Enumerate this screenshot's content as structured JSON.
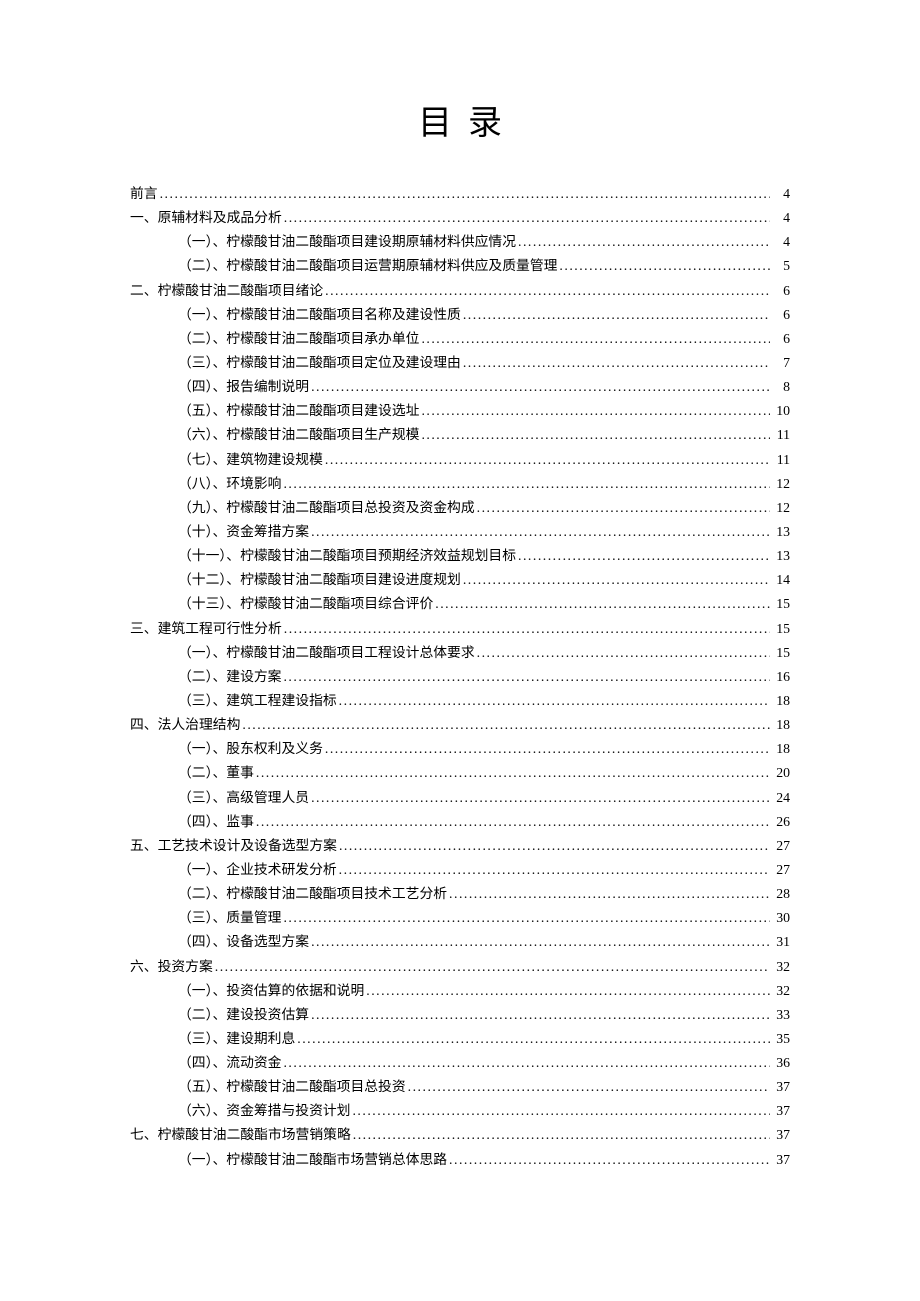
{
  "title": "目录",
  "toc": [
    {
      "level": 1,
      "label": "前言",
      "page": "4"
    },
    {
      "level": 1,
      "label": "一、原辅材料及成品分析",
      "page": "4"
    },
    {
      "level": 2,
      "label": "（一）、柠檬酸甘油二酸酯项目建设期原辅材料供应情况",
      "page": "4"
    },
    {
      "level": 2,
      "label": "（二）、柠檬酸甘油二酸酯项目运营期原辅材料供应及质量管理",
      "page": "5"
    },
    {
      "level": 1,
      "label": "二、柠檬酸甘油二酸酯项目绪论",
      "page": "6"
    },
    {
      "level": 2,
      "label": "（一）、柠檬酸甘油二酸酯项目名称及建设性质",
      "page": "6"
    },
    {
      "level": 2,
      "label": "（二）、柠檬酸甘油二酸酯项目承办单位",
      "page": "6"
    },
    {
      "level": 2,
      "label": "（三）、柠檬酸甘油二酸酯项目定位及建设理由",
      "page": "7"
    },
    {
      "level": 2,
      "label": "（四）、报告编制说明",
      "page": "8"
    },
    {
      "level": 2,
      "label": "（五）、柠檬酸甘油二酸酯项目建设选址",
      "page": "10"
    },
    {
      "level": 2,
      "label": "（六）、柠檬酸甘油二酸酯项目生产规模",
      "page": "11"
    },
    {
      "level": 2,
      "label": "（七）、建筑物建设规模",
      "page": "11"
    },
    {
      "level": 2,
      "label": "（八）、环境影响",
      "page": "12"
    },
    {
      "level": 2,
      "label": "（九）、柠檬酸甘油二酸酯项目总投资及资金构成",
      "page": "12"
    },
    {
      "level": 2,
      "label": "（十）、资金筹措方案",
      "page": "13"
    },
    {
      "level": 2,
      "label": "（十一）、柠檬酸甘油二酸酯项目预期经济效益规划目标",
      "page": "13"
    },
    {
      "level": 2,
      "label": "（十二）、柠檬酸甘油二酸酯项目建设进度规划",
      "page": "14"
    },
    {
      "level": 2,
      "label": "（十三）、柠檬酸甘油二酸酯项目综合评价",
      "page": "15"
    },
    {
      "level": 1,
      "label": "三、建筑工程可行性分析",
      "page": "15"
    },
    {
      "level": 2,
      "label": "（一）、柠檬酸甘油二酸酯项目工程设计总体要求",
      "page": "15"
    },
    {
      "level": 2,
      "label": "（二）、建设方案",
      "page": "16"
    },
    {
      "level": 2,
      "label": "（三）、建筑工程建设指标",
      "page": "18"
    },
    {
      "level": 1,
      "label": "四、法人治理结构",
      "page": "18"
    },
    {
      "level": 2,
      "label": "（一）、股东权利及义务",
      "page": "18"
    },
    {
      "level": 2,
      "label": "（二）、董事",
      "page": "20"
    },
    {
      "level": 2,
      "label": "（三）、高级管理人员",
      "page": "24"
    },
    {
      "level": 2,
      "label": "（四）、监事",
      "page": "26"
    },
    {
      "level": 1,
      "label": "五、工艺技术设计及设备选型方案",
      "page": "27"
    },
    {
      "level": 2,
      "label": "（一）、企业技术研发分析",
      "page": "27"
    },
    {
      "level": 2,
      "label": "（二）、柠檬酸甘油二酸酯项目技术工艺分析",
      "page": "28"
    },
    {
      "level": 2,
      "label": "（三）、质量管理",
      "page": "30"
    },
    {
      "level": 2,
      "label": "（四）、设备选型方案",
      "page": "31"
    },
    {
      "level": 1,
      "label": "六、投资方案",
      "page": "32"
    },
    {
      "level": 2,
      "label": "（一）、投资估算的依据和说明",
      "page": "32"
    },
    {
      "level": 2,
      "label": "（二）、建设投资估算",
      "page": "33"
    },
    {
      "level": 2,
      "label": "（三）、建设期利息",
      "page": "35"
    },
    {
      "level": 2,
      "label": "（四）、流动资金",
      "page": "36"
    },
    {
      "level": 2,
      "label": "（五）、柠檬酸甘油二酸酯项目总投资",
      "page": "37"
    },
    {
      "level": 2,
      "label": "（六）、资金筹措与投资计划",
      "page": "37"
    },
    {
      "level": 1,
      "label": "七、柠檬酸甘油二酸酯市场营销策略",
      "page": "37"
    },
    {
      "level": 2,
      "label": "（一）、柠檬酸甘油二酸酯市场营销总体思路",
      "page": "37"
    }
  ]
}
